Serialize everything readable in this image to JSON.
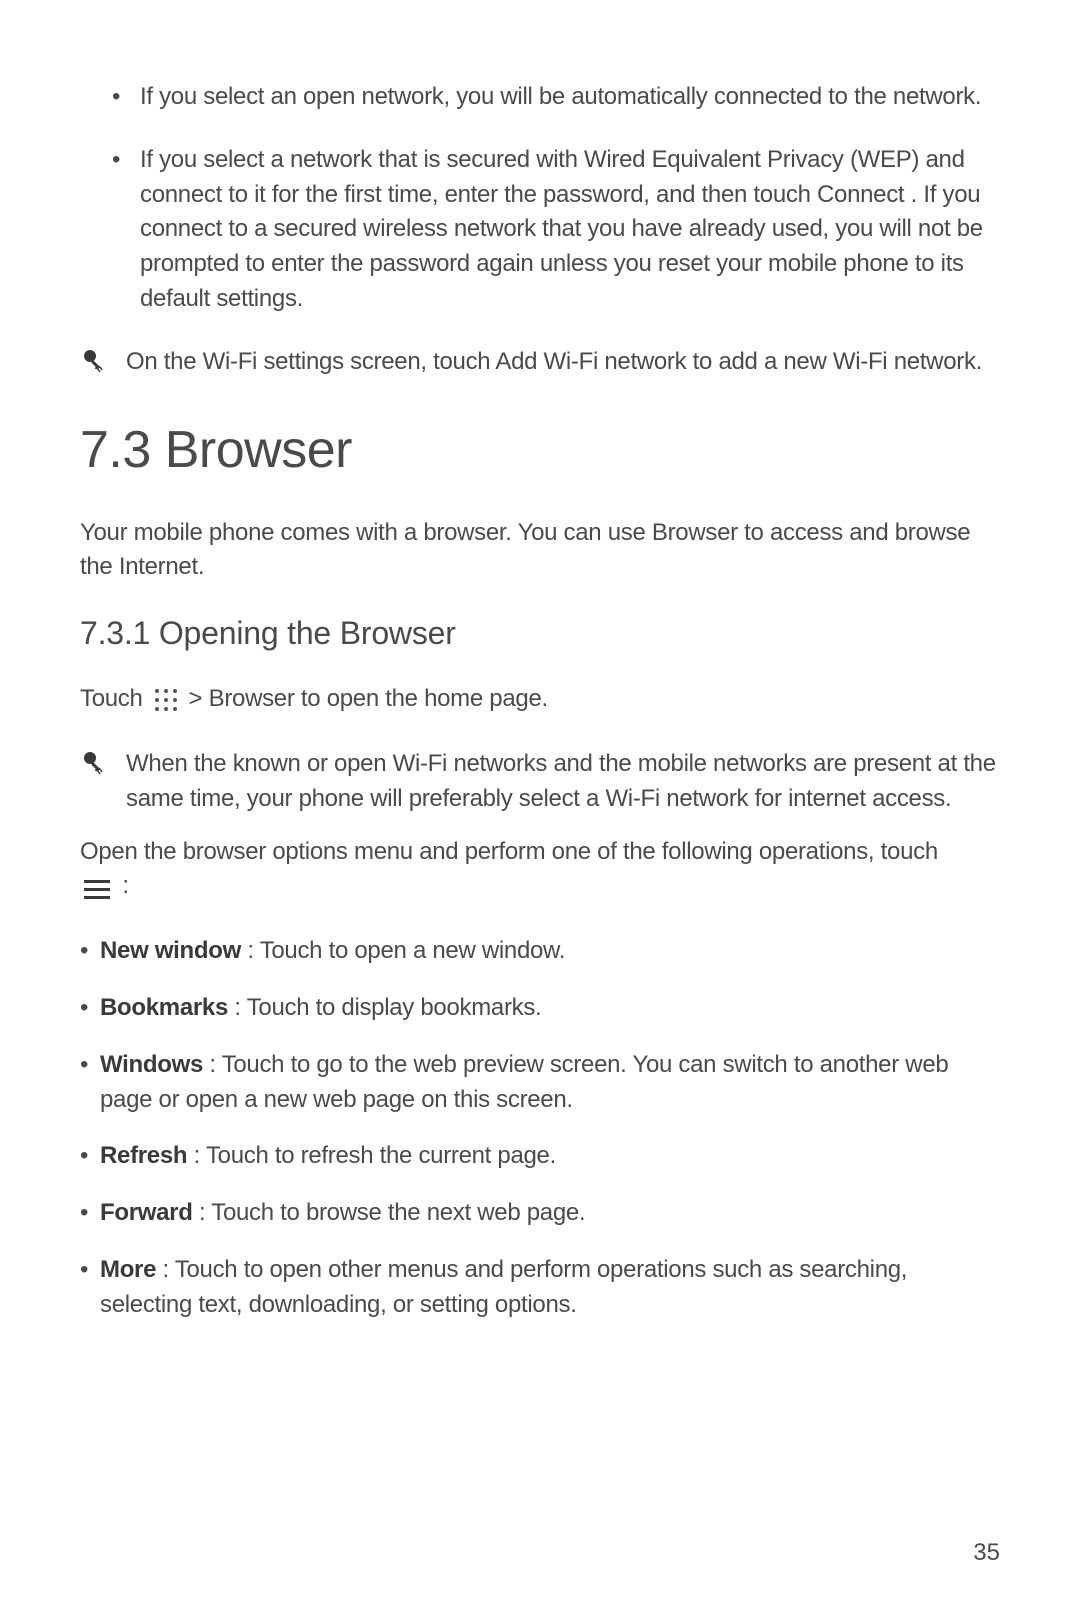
{
  "intro_bullets": [
    "If you select an open network, you will be automatically connected to the network.",
    "If you select a network that is secured with Wired Equivalent Privacy (WEP) and connect to it for the first time, enter the password, and then touch Connect . If you connect to a secured wireless network that you have already used, you will not be prompted to enter the password again unless you reset your mobile phone to its default settings."
  ],
  "tip1": "On the Wi-Fi settings   screen, touch Add Wi-Fi network   to add a new Wi-Fi network.",
  "heading": "7.3  Browser",
  "intro_para": "Your mobile phone comes with a browser. You can use Browser  to access and browse the Internet.",
  "subheading": "7.3.1  Opening the Browser",
  "touch_pre": "Touch",
  "touch_post": "> Browser  to open the home page.",
  "tip2": "When the known or open Wi-Fi networks and the mobile networks are present at the same time, your phone will preferably select a Wi-Fi network for internet access.",
  "options_intro_pre": "Open the browser options menu and perform one of the following operations, touch",
  "options_intro_post": ":",
  "options": [
    {
      "label": "New window",
      "sep": "  : ",
      "desc": "Touch to open a new window."
    },
    {
      "label": "Bookmarks",
      "sep": "  : ",
      "desc": "Touch to display bookmarks."
    },
    {
      "label": "Windows",
      "sep": "  : ",
      "desc": "Touch to go to the web preview screen. You can switch to another web page or open a new web page on this screen."
    },
    {
      "label": "Refresh",
      "sep": " : ",
      "desc": "Touch to refresh the current page."
    },
    {
      "label": "Forward",
      "sep": " : ",
      "desc": "Touch to browse the next web page."
    },
    {
      "label": "More",
      "sep": " : ",
      "desc": "Touch to open other menus and perform operations such as searching, selecting text, downloading, or setting options."
    }
  ],
  "page_number": "35"
}
